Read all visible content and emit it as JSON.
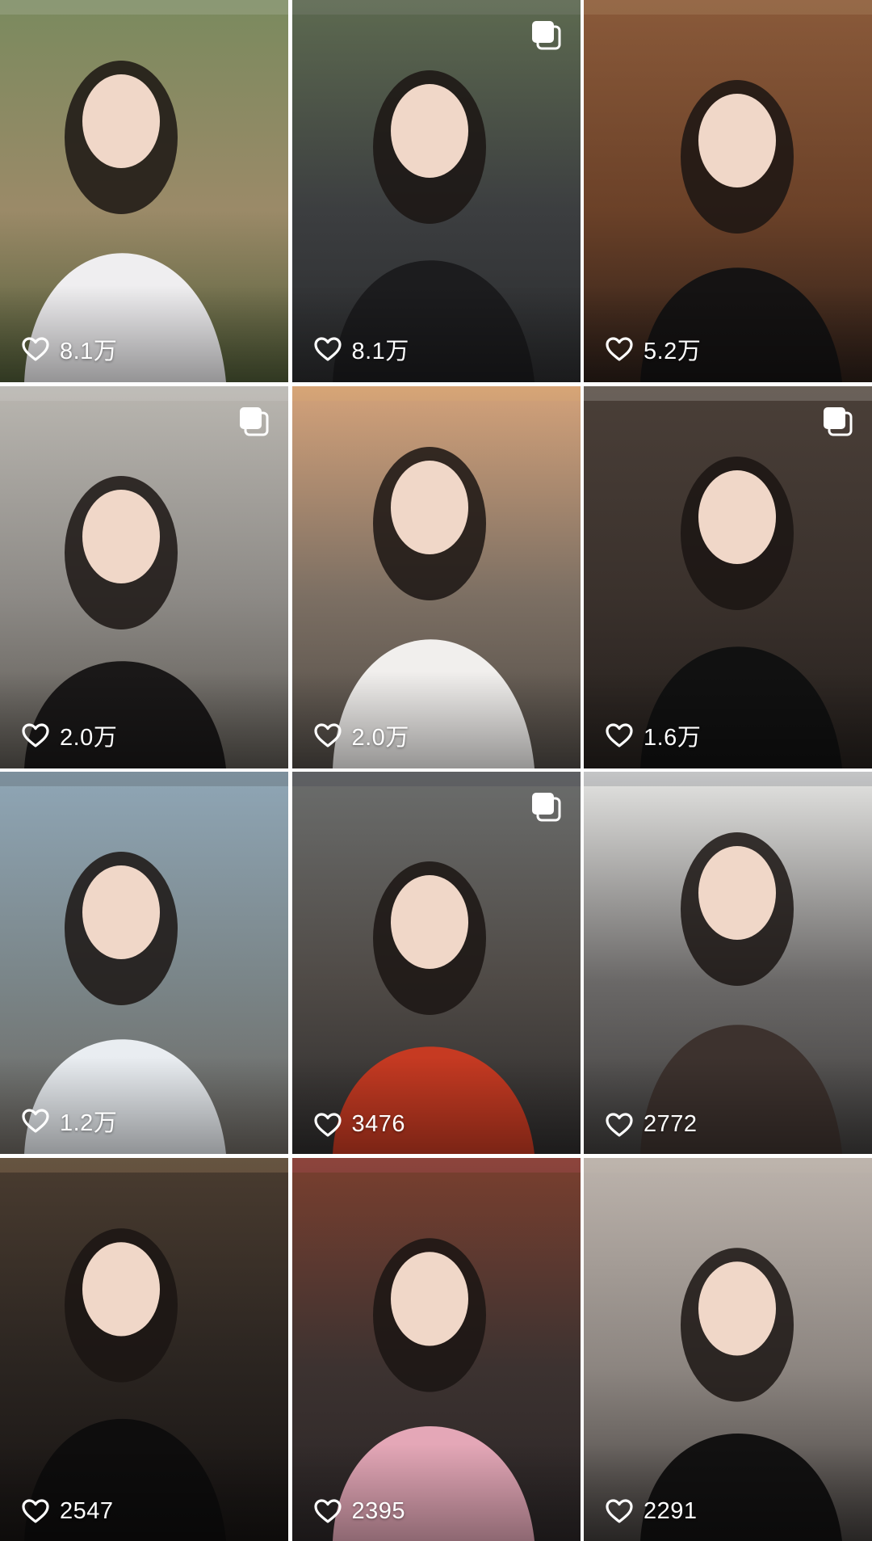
{
  "posts": [
    {
      "likes": "8.1万",
      "multi_image": false,
      "palette": {
        "top": "#7a8a5e",
        "mid": "#9b8a68",
        "bottom": "#4e5a36",
        "figure": "#efeef0",
        "accent": "#d8d8d8"
      }
    },
    {
      "likes": "8.1万",
      "multi_image": true,
      "palette": {
        "top": "#5d6a50",
        "mid": "#3c3e40",
        "bottom": "#2a2b2d",
        "figure": "#1c1c1e",
        "accent": "#9a9a9a"
      }
    },
    {
      "likes": "5.2万",
      "multi_image": false,
      "palette": {
        "top": "#8a5a3a",
        "mid": "#6b4128",
        "bottom": "#2b1e18",
        "figure": "#151313",
        "accent": "#cdb38a"
      }
    },
    {
      "likes": "2.0万",
      "multi_image": true,
      "palette": {
        "top": "#b9b6b0",
        "mid": "#8d8a86",
        "bottom": "#5a5650",
        "figure": "#1a1818",
        "accent": "#dedede"
      }
    },
    {
      "likes": "2.0万",
      "multi_image": false,
      "palette": {
        "top": "#d4a27a",
        "mid": "#7c6f63",
        "bottom": "#4f4a45",
        "figure": "#f1efed",
        "accent": "#e6b36a"
      }
    },
    {
      "likes": "1.6万",
      "multi_image": true,
      "palette": {
        "top": "#4a3f38",
        "mid": "#3a312c",
        "bottom": "#241f1c",
        "figure": "#111111",
        "accent": "#fffef6"
      }
    },
    {
      "likes": "1.2万",
      "multi_image": false,
      "palette": {
        "top": "#8fa6b6",
        "mid": "#7a8588",
        "bottom": "#6b6660",
        "figure": "#e9edf1",
        "accent": "#2c2b2d"
      }
    },
    {
      "likes": "3476",
      "multi_image": true,
      "palette": {
        "top": "#6b6d6c",
        "mid": "#4f4a46",
        "bottom": "#2e2c2c",
        "figure": "#c63a22",
        "accent": "#2a2f45"
      }
    },
    {
      "likes": "2772",
      "multi_image": false,
      "palette": {
        "top": "#e5e5e3",
        "mid": "#6a6867",
        "bottom": "#3f3d3c",
        "figure": "#3d322e",
        "accent": "#2a3040"
      }
    },
    {
      "likes": "2547",
      "multi_image": false,
      "palette": {
        "top": "#4a3c30",
        "mid": "#2a2420",
        "bottom": "#161312",
        "figure": "#0e0d0d",
        "accent": "#e9c28a"
      }
    },
    {
      "likes": "2395",
      "multi_image": false,
      "palette": {
        "top": "#7a3f2f",
        "mid": "#3c3230",
        "bottom": "#2a2526",
        "figure": "#e4a7b7",
        "accent": "#e25d7a"
      }
    },
    {
      "likes": "2291",
      "multi_image": false,
      "palette": {
        "top": "#bcb3ac",
        "mid": "#8c8580",
        "bottom": "#403c3a",
        "figure": "#121111",
        "accent": "#c9bdb2"
      }
    }
  ],
  "icons": {
    "like": "heart-outline-icon",
    "multi": "multi-image-icon"
  }
}
